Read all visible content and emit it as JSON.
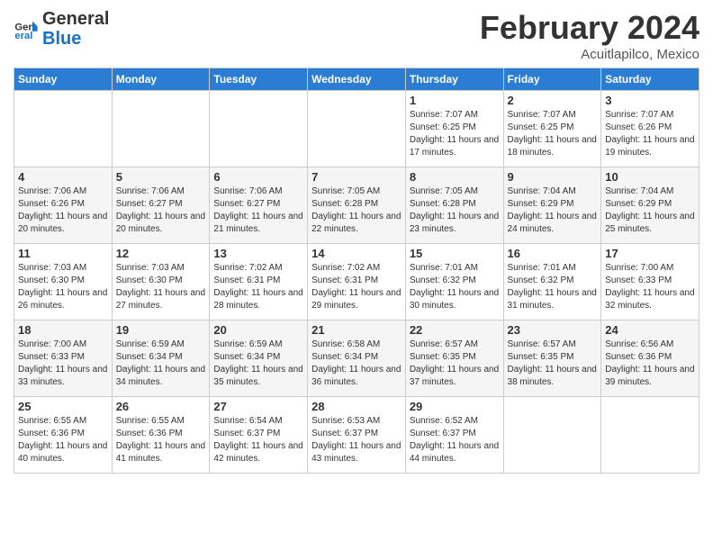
{
  "header": {
    "logo_general": "General",
    "logo_blue": "Blue",
    "month": "February 2024",
    "location": "Acuitlapilco, Mexico"
  },
  "weekdays": [
    "Sunday",
    "Monday",
    "Tuesday",
    "Wednesday",
    "Thursday",
    "Friday",
    "Saturday"
  ],
  "weeks": [
    [
      {
        "day": "",
        "sunrise": "",
        "sunset": "",
        "daylight": ""
      },
      {
        "day": "",
        "sunrise": "",
        "sunset": "",
        "daylight": ""
      },
      {
        "day": "",
        "sunrise": "",
        "sunset": "",
        "daylight": ""
      },
      {
        "day": "",
        "sunrise": "",
        "sunset": "",
        "daylight": ""
      },
      {
        "day": "1",
        "sunrise": "Sunrise: 7:07 AM",
        "sunset": "Sunset: 6:25 PM",
        "daylight": "Daylight: 11 hours and 17 minutes."
      },
      {
        "day": "2",
        "sunrise": "Sunrise: 7:07 AM",
        "sunset": "Sunset: 6:25 PM",
        "daylight": "Daylight: 11 hours and 18 minutes."
      },
      {
        "day": "3",
        "sunrise": "Sunrise: 7:07 AM",
        "sunset": "Sunset: 6:26 PM",
        "daylight": "Daylight: 11 hours and 19 minutes."
      }
    ],
    [
      {
        "day": "4",
        "sunrise": "Sunrise: 7:06 AM",
        "sunset": "Sunset: 6:26 PM",
        "daylight": "Daylight: 11 hours and 20 minutes."
      },
      {
        "day": "5",
        "sunrise": "Sunrise: 7:06 AM",
        "sunset": "Sunset: 6:27 PM",
        "daylight": "Daylight: 11 hours and 20 minutes."
      },
      {
        "day": "6",
        "sunrise": "Sunrise: 7:06 AM",
        "sunset": "Sunset: 6:27 PM",
        "daylight": "Daylight: 11 hours and 21 minutes."
      },
      {
        "day": "7",
        "sunrise": "Sunrise: 7:05 AM",
        "sunset": "Sunset: 6:28 PM",
        "daylight": "Daylight: 11 hours and 22 minutes."
      },
      {
        "day": "8",
        "sunrise": "Sunrise: 7:05 AM",
        "sunset": "Sunset: 6:28 PM",
        "daylight": "Daylight: 11 hours and 23 minutes."
      },
      {
        "day": "9",
        "sunrise": "Sunrise: 7:04 AM",
        "sunset": "Sunset: 6:29 PM",
        "daylight": "Daylight: 11 hours and 24 minutes."
      },
      {
        "day": "10",
        "sunrise": "Sunrise: 7:04 AM",
        "sunset": "Sunset: 6:29 PM",
        "daylight": "Daylight: 11 hours and 25 minutes."
      }
    ],
    [
      {
        "day": "11",
        "sunrise": "Sunrise: 7:03 AM",
        "sunset": "Sunset: 6:30 PM",
        "daylight": "Daylight: 11 hours and 26 minutes."
      },
      {
        "day": "12",
        "sunrise": "Sunrise: 7:03 AM",
        "sunset": "Sunset: 6:30 PM",
        "daylight": "Daylight: 11 hours and 27 minutes."
      },
      {
        "day": "13",
        "sunrise": "Sunrise: 7:02 AM",
        "sunset": "Sunset: 6:31 PM",
        "daylight": "Daylight: 11 hours and 28 minutes."
      },
      {
        "day": "14",
        "sunrise": "Sunrise: 7:02 AM",
        "sunset": "Sunset: 6:31 PM",
        "daylight": "Daylight: 11 hours and 29 minutes."
      },
      {
        "day": "15",
        "sunrise": "Sunrise: 7:01 AM",
        "sunset": "Sunset: 6:32 PM",
        "daylight": "Daylight: 11 hours and 30 minutes."
      },
      {
        "day": "16",
        "sunrise": "Sunrise: 7:01 AM",
        "sunset": "Sunset: 6:32 PM",
        "daylight": "Daylight: 11 hours and 31 minutes."
      },
      {
        "day": "17",
        "sunrise": "Sunrise: 7:00 AM",
        "sunset": "Sunset: 6:33 PM",
        "daylight": "Daylight: 11 hours and 32 minutes."
      }
    ],
    [
      {
        "day": "18",
        "sunrise": "Sunrise: 7:00 AM",
        "sunset": "Sunset: 6:33 PM",
        "daylight": "Daylight: 11 hours and 33 minutes."
      },
      {
        "day": "19",
        "sunrise": "Sunrise: 6:59 AM",
        "sunset": "Sunset: 6:34 PM",
        "daylight": "Daylight: 11 hours and 34 minutes."
      },
      {
        "day": "20",
        "sunrise": "Sunrise: 6:59 AM",
        "sunset": "Sunset: 6:34 PM",
        "daylight": "Daylight: 11 hours and 35 minutes."
      },
      {
        "day": "21",
        "sunrise": "Sunrise: 6:58 AM",
        "sunset": "Sunset: 6:34 PM",
        "daylight": "Daylight: 11 hours and 36 minutes."
      },
      {
        "day": "22",
        "sunrise": "Sunrise: 6:57 AM",
        "sunset": "Sunset: 6:35 PM",
        "daylight": "Daylight: 11 hours and 37 minutes."
      },
      {
        "day": "23",
        "sunrise": "Sunrise: 6:57 AM",
        "sunset": "Sunset: 6:35 PM",
        "daylight": "Daylight: 11 hours and 38 minutes."
      },
      {
        "day": "24",
        "sunrise": "Sunrise: 6:56 AM",
        "sunset": "Sunset: 6:36 PM",
        "daylight": "Daylight: 11 hours and 39 minutes."
      }
    ],
    [
      {
        "day": "25",
        "sunrise": "Sunrise: 6:55 AM",
        "sunset": "Sunset: 6:36 PM",
        "daylight": "Daylight: 11 hours and 40 minutes."
      },
      {
        "day": "26",
        "sunrise": "Sunrise: 6:55 AM",
        "sunset": "Sunset: 6:36 PM",
        "daylight": "Daylight: 11 hours and 41 minutes."
      },
      {
        "day": "27",
        "sunrise": "Sunrise: 6:54 AM",
        "sunset": "Sunset: 6:37 PM",
        "daylight": "Daylight: 11 hours and 42 minutes."
      },
      {
        "day": "28",
        "sunrise": "Sunrise: 6:53 AM",
        "sunset": "Sunset: 6:37 PM",
        "daylight": "Daylight: 11 hours and 43 minutes."
      },
      {
        "day": "29",
        "sunrise": "Sunrise: 6:52 AM",
        "sunset": "Sunset: 6:37 PM",
        "daylight": "Daylight: 11 hours and 44 minutes."
      },
      {
        "day": "",
        "sunrise": "",
        "sunset": "",
        "daylight": ""
      },
      {
        "day": "",
        "sunrise": "",
        "sunset": "",
        "daylight": ""
      }
    ]
  ]
}
